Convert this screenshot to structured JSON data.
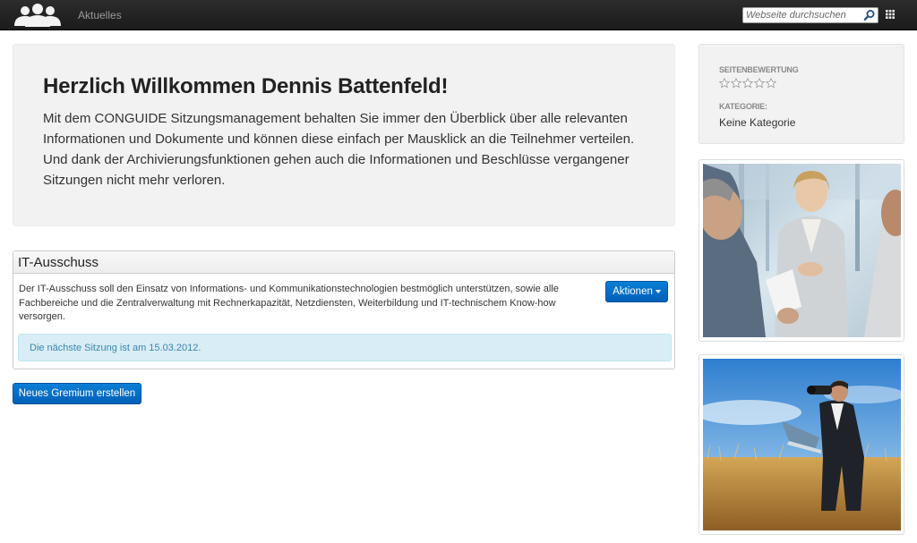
{
  "nav": {
    "logo_icon": "users-group-icon",
    "link_current": "Aktuelles",
    "search_placeholder": "Webseite durchsuchen",
    "search_icon": "magnifier-icon",
    "apps_icon": "grid-icon"
  },
  "welcome": {
    "heading": "Herzlich Willkommen Dennis Battenfeld!",
    "text": "Mit dem CONGUIDE Sitzungsmanagement behalten Sie immer den Überblick über alle relevanten Informationen und Dokumente und können diese einfach per Mausklick an die Teilnehmer verteilen. Und dank der Archivierungsfunktionen gehen auch die Informationen und Beschlüsse vergangener Sitzungen nicht mehr verloren."
  },
  "committee": {
    "title": "IT-Ausschuss",
    "description": "Der IT-Ausschuss soll den Einsatz von Informations- und Kommunikationstechnologien bestmöglich unterstützen, sowie alle Fachbereiche und die Zentralverwaltung mit Rechnerkapazität, Netzdiensten, Weiterbildung und IT-technischem Know-how versorgen.",
    "actions_label": "Aktionen",
    "next_meeting": "Die nächste Sitzung ist am 15.03.2012."
  },
  "new_committee_label": "Neues Gremium erstellen",
  "sidebar": {
    "rating_label": "SEITENBEWERTUNG",
    "rating_value": 0,
    "rating_max": 5,
    "category_label": "KATEGORIE:",
    "category_value": "Keine Kategorie"
  },
  "colors": {
    "topbar": "#1f1f1f",
    "primary_button": "#0070c9",
    "alert_bg": "#d9edf7",
    "alert_text": "#3a87ad"
  }
}
